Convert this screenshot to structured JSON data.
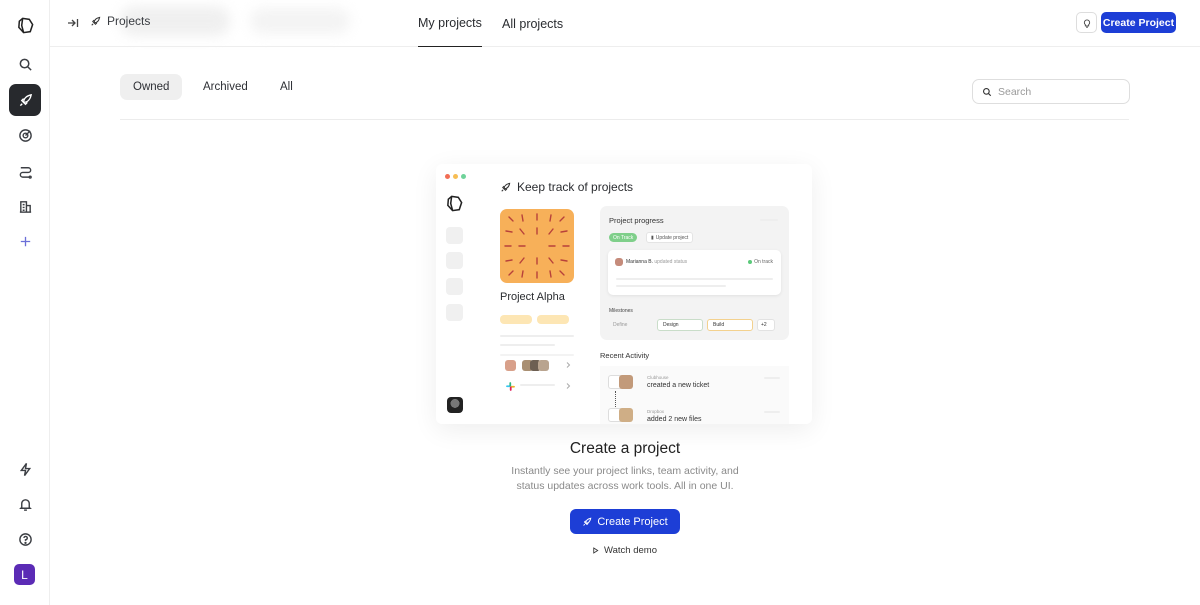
{
  "sidebar": {
    "items": [
      {
        "name": "search",
        "icon": "search-icon"
      },
      {
        "name": "projects",
        "icon": "rocket-icon",
        "active": true
      },
      {
        "name": "goals",
        "icon": "target-icon"
      },
      {
        "name": "flows",
        "icon": "route-icon"
      },
      {
        "name": "company",
        "icon": "building-icon"
      },
      {
        "name": "add",
        "icon": "plus-icon"
      }
    ],
    "bottom_items": [
      {
        "name": "updates",
        "icon": "lightning-icon"
      },
      {
        "name": "notifications",
        "icon": "bell-icon"
      },
      {
        "name": "help",
        "icon": "help-icon"
      }
    ],
    "avatar_initial": "L",
    "avatar_color": "#5b2bb5"
  },
  "header": {
    "breadcrumb": "Projects",
    "tabs": [
      {
        "label": "My projects",
        "active": true
      },
      {
        "label": "All projects",
        "active": false
      }
    ],
    "create_button": "Create Project"
  },
  "filters": {
    "items": [
      {
        "label": "Owned",
        "active": true
      },
      {
        "label": "Archived",
        "active": false
      },
      {
        "label": "All",
        "active": false
      }
    ],
    "search_placeholder": "Search"
  },
  "illustration": {
    "title": "Keep track of projects",
    "project_name": "Project Alpha",
    "progress_title": "Project progress",
    "status_badge": "On Track",
    "update_label": "Update project",
    "update_user": "Marianna B.",
    "update_text": "updated status",
    "update_status": "On track",
    "milestones_label": "Milestones",
    "milestones": [
      "Define",
      "Design",
      "Build",
      "+2"
    ],
    "recent_activity_label": "Recent Activity",
    "activities": [
      {
        "source": "Clubhouse",
        "text": "created a new ticket"
      },
      {
        "source": "Dropbox",
        "text": "added 2 new files"
      }
    ]
  },
  "empty_state": {
    "title": "Create a project",
    "description": "Instantly see your project links, team activity, and status updates across work tools. All in one UI.",
    "button": "Create Project",
    "watch_demo": "Watch demo"
  },
  "colors": {
    "accent": "#1d3ed6",
    "on_track": "#7fcf8a",
    "tile": "#f7b059"
  }
}
